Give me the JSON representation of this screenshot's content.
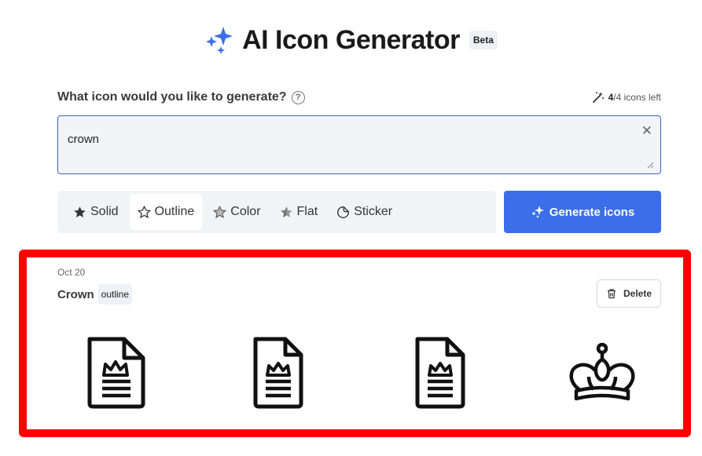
{
  "header": {
    "title": "AI Icon Generator",
    "badge": "Beta",
    "logo_icon": "sparkles-icon"
  },
  "prompt": {
    "label": "What icon would you like to generate?",
    "help_icon": "?",
    "credits_used": "4",
    "credits_total": "/4 icons left",
    "value": "crown",
    "clear_icon": "✕"
  },
  "styles": [
    {
      "label": "Solid",
      "icon": "star-solid-icon",
      "active": false
    },
    {
      "label": "Outline",
      "icon": "star-outline-icon",
      "active": true
    },
    {
      "label": "Color",
      "icon": "star-color-icon",
      "active": false
    },
    {
      "label": "Flat",
      "icon": "star-flat-icon",
      "active": false
    },
    {
      "label": "Sticker",
      "icon": "sticker-icon",
      "active": false
    }
  ],
  "generate_label": "Generate icons",
  "result": {
    "date": "Oct 20",
    "name": "Crown",
    "tag": "outline",
    "delete_label": "Delete",
    "icons": [
      "document-crown-icon",
      "document-crown-icon",
      "document-crown-icon",
      "crown-icon"
    ]
  },
  "colors": {
    "accent": "#3b6ee8",
    "highlight_frame": "#ff0000"
  }
}
